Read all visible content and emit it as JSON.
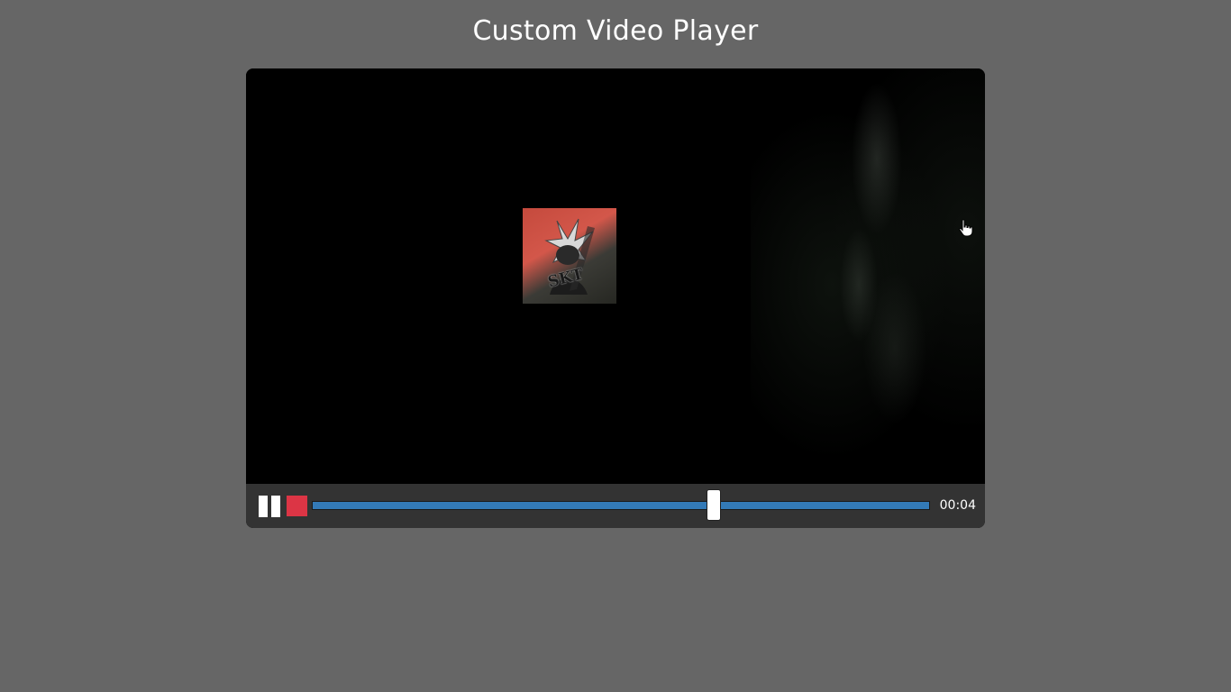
{
  "page": {
    "title": "Custom Video Player"
  },
  "video": {
    "logo_text": "SKT",
    "cursor_icon": "hand-pointer-icon"
  },
  "controls": {
    "play_pause_icon": "pause-icon",
    "stop_icon": "stop-icon",
    "progress_fraction": 0.651,
    "timestamp": "00:04"
  },
  "colors": {
    "background": "#666666",
    "controls_bar": "#333333",
    "progress_fill": "#337ab7",
    "stop_button": "#dc3545"
  }
}
